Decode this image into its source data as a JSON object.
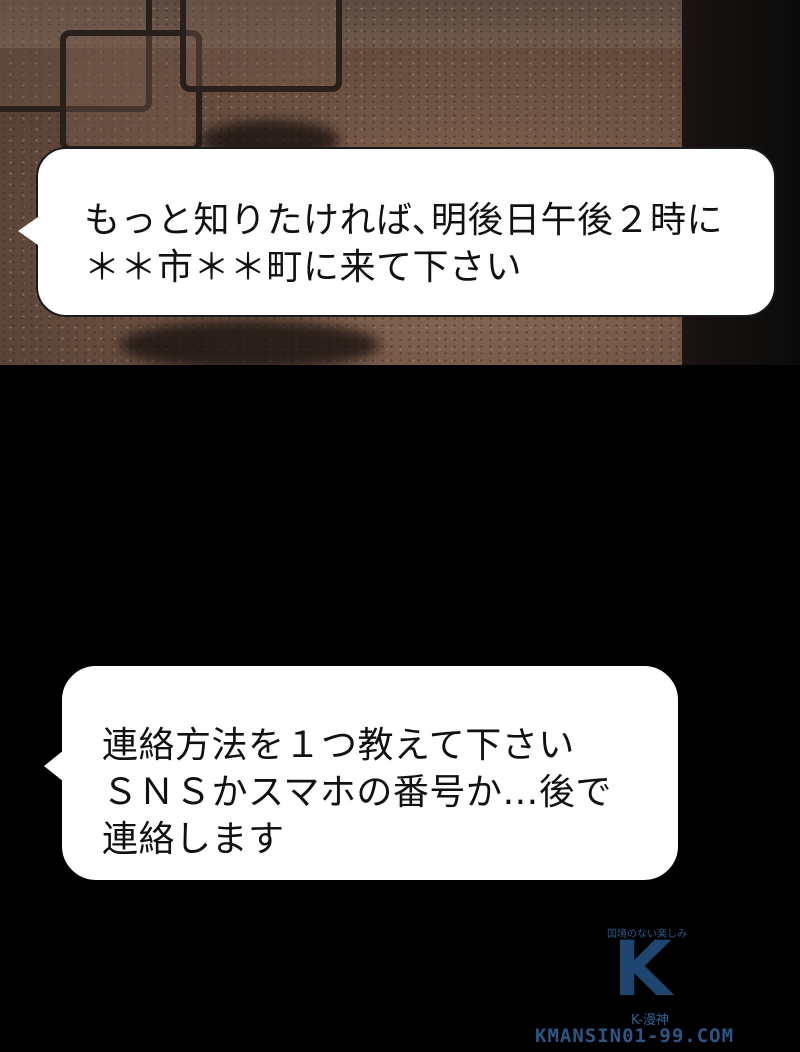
{
  "bubble1": {
    "lines": "もっと知りたければ､明後日午後２時に\n＊＊市＊＊町に来て下さい"
  },
  "bubble2": {
    "lines": "連絡方法を１つ教えて下さい\nＳＮＳかスマホの番号か…後で\n連絡します"
  },
  "watermark": {
    "tagline": "国境のない楽しみ",
    "logo": "K",
    "brand": "K-漫神",
    "url": "KMANSIN01-99.COM"
  }
}
